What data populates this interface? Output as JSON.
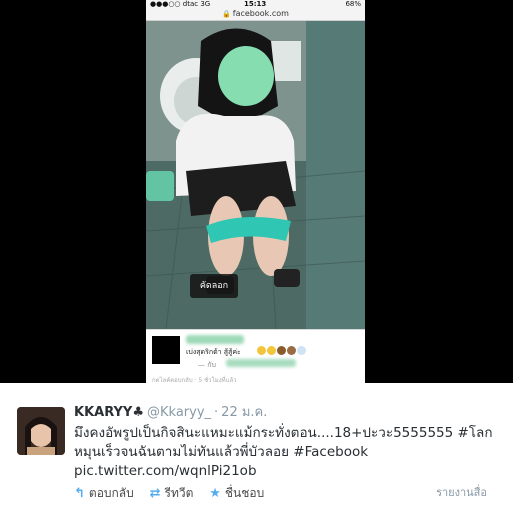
{
  "phone": {
    "status": {
      "carrier": "●●●○○ dtac  3G",
      "time": "15:13",
      "battery": "68%"
    },
    "url": "facebook.com",
    "copy_button": "คัดลอก",
    "fb_comment": {
      "text": "เบ่งสุดริกต้า สู้สู้ค่ะ",
      "reply": "— กับ",
      "meta": "กดไลค์ตอบกลับ · 5 ชั่วโมงที่แล้ว"
    }
  },
  "tweet": {
    "display_name": "KKARYY♣",
    "username": "@Kkaryy_",
    "dot": "·",
    "timestamp": "22 ม.ค.",
    "text": "มึงคงอัพรูปเป็นกิจสินะแหมะแม้กระทั่งตอน....18+ปะวะ5555555 #โลกหมุนเร็วจนฉันตามไม่ทันแล้วพี่บัวลอย #Facebook",
    "link": "pic.twitter.com/wqnlPi21ob",
    "actions": {
      "reply": "ตอบกลับ",
      "retweet": "รีทวีต",
      "favorite": "ชื่นชอบ"
    },
    "report": "รายงานสื่อ"
  },
  "colors": {
    "link_blue": "#55acee",
    "text_dark": "#292f33",
    "muted": "#8899a6",
    "censor_green": "#86ddb0"
  }
}
